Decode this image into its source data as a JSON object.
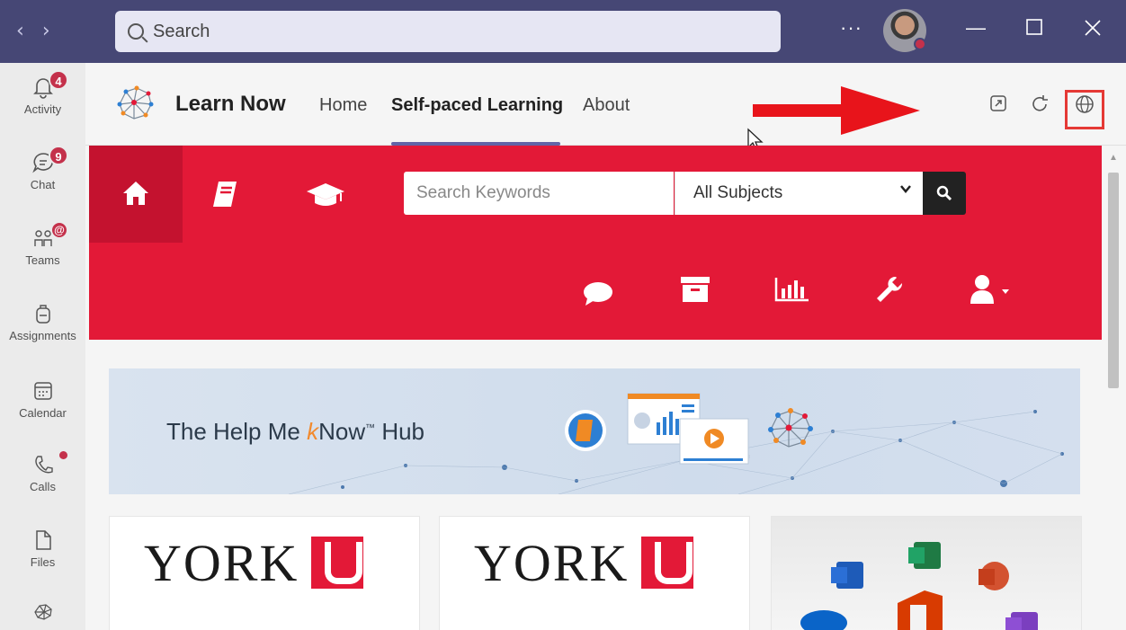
{
  "titlebar": {
    "search_placeholder": "Search",
    "more_label": "···"
  },
  "rail": {
    "items": [
      {
        "label": "Activity",
        "badge": "4"
      },
      {
        "label": "Chat",
        "badge": "9"
      },
      {
        "label": "Teams",
        "badge": "@"
      },
      {
        "label": "Assignments"
      },
      {
        "label": "Calendar"
      },
      {
        "label": "Calls"
      },
      {
        "label": "Files"
      }
    ]
  },
  "app": {
    "title": "Learn Now",
    "tabs": [
      "Home",
      "Self-paced Learning",
      "About"
    ],
    "active_tab": "Self-paced Learning"
  },
  "portal": {
    "search_placeholder": "Search Keywords",
    "subject_selected": "All Subjects",
    "brand_red": "#e31937"
  },
  "banner": {
    "prefix": "The Help Me ",
    "k": "k",
    "suffix": "Now",
    "tm": "™",
    "hub": " Hub"
  },
  "cards": {
    "york_text": "YORK"
  },
  "colors": {
    "teams_purple": "#464775",
    "accent": "#6264a7",
    "highlight_box": "#e53935"
  }
}
